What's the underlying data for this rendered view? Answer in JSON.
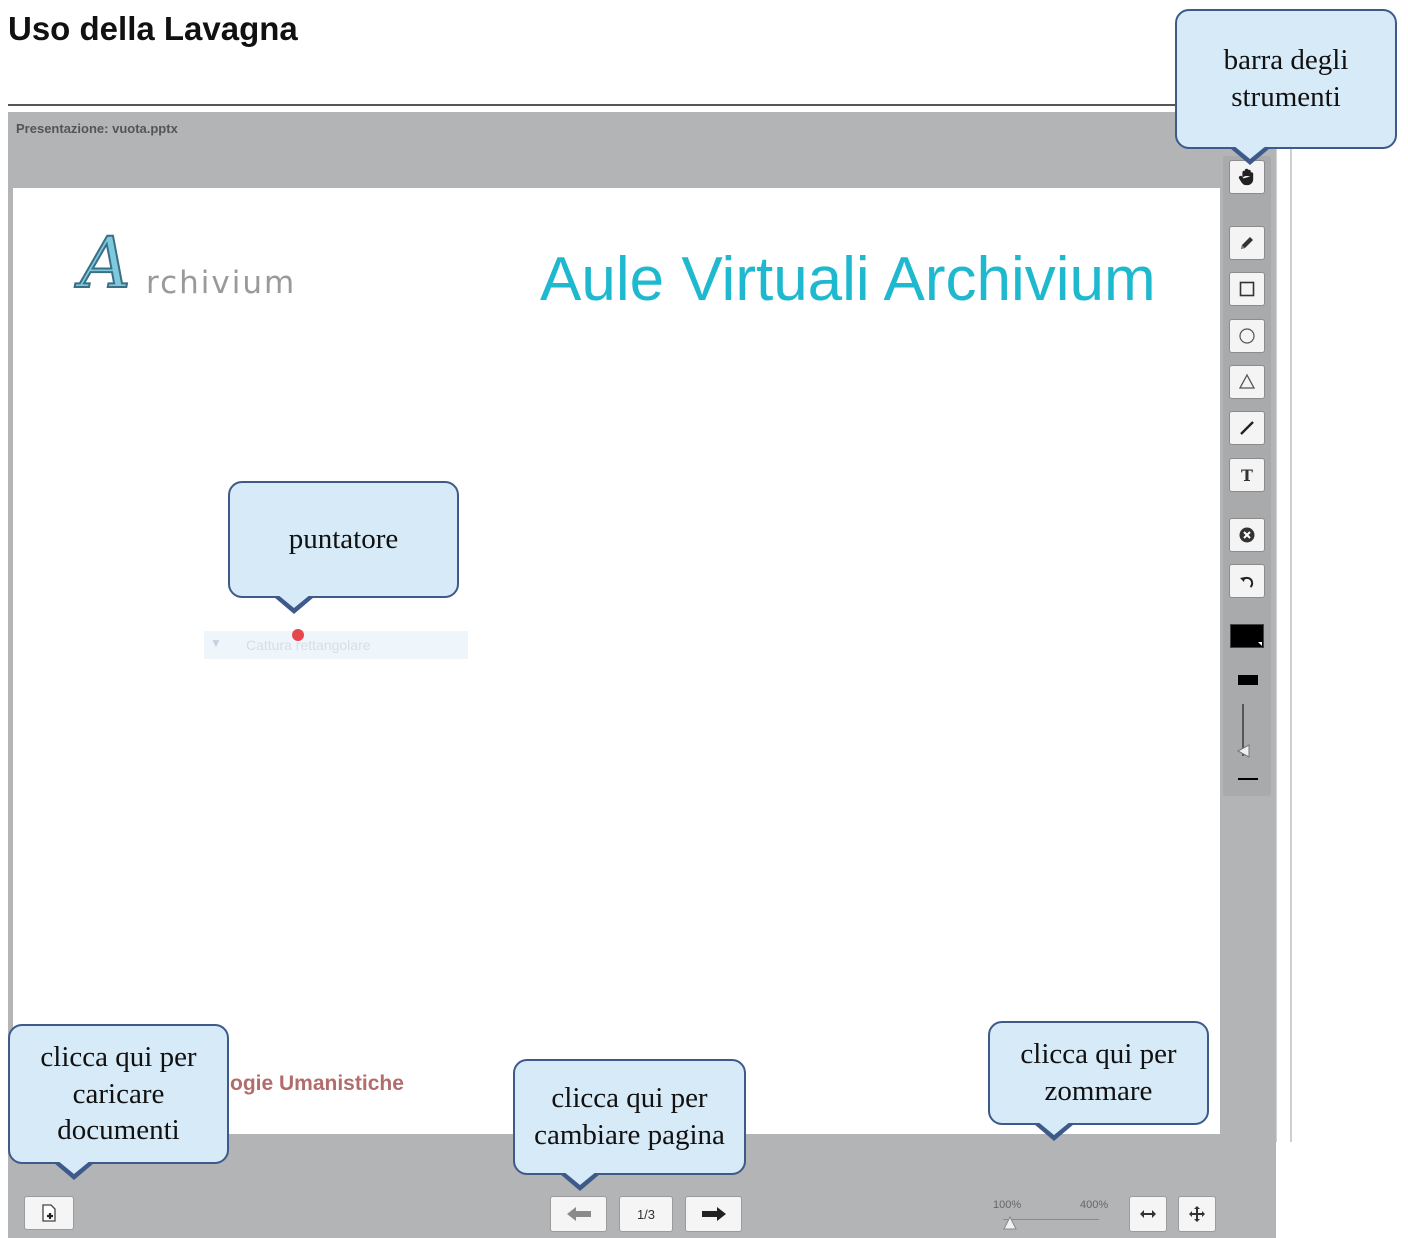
{
  "page": {
    "title": "Uso della Lavagna"
  },
  "whiteboard": {
    "presentation_label": "Presentazione: vuota.pptx",
    "slide": {
      "logo_letter": "A",
      "logo_text": "rchivium",
      "title": "Aule Virtuali Archivium",
      "footer_partial": "ogie Umanistiche",
      "ghost_tool_text": "Cattura rettangolare"
    },
    "toolbar": {
      "tools": [
        "pan-hand",
        "pencil",
        "rectangle",
        "circle",
        "triangle",
        "line",
        "text",
        "clear",
        "undo",
        "color-picker",
        "thickness",
        "size-slider"
      ],
      "color": "#000000"
    },
    "pagination": {
      "current": "1/3"
    },
    "zoom": {
      "min_label": "100%",
      "max_label": "400%",
      "level": 0.0
    }
  },
  "callouts": {
    "toolbar": "barra degli strumenti",
    "pointer": "puntatore",
    "upload": "clicca qui per caricare documenti",
    "page": "clicca qui per cambiare pagina",
    "zoom": "clicca qui per zommare"
  },
  "colors": {
    "callout_fill": "#d7eaf7",
    "callout_border": "#3d5a8a",
    "slide_title": "#1fb9cf",
    "pointer": "#e8464f"
  }
}
